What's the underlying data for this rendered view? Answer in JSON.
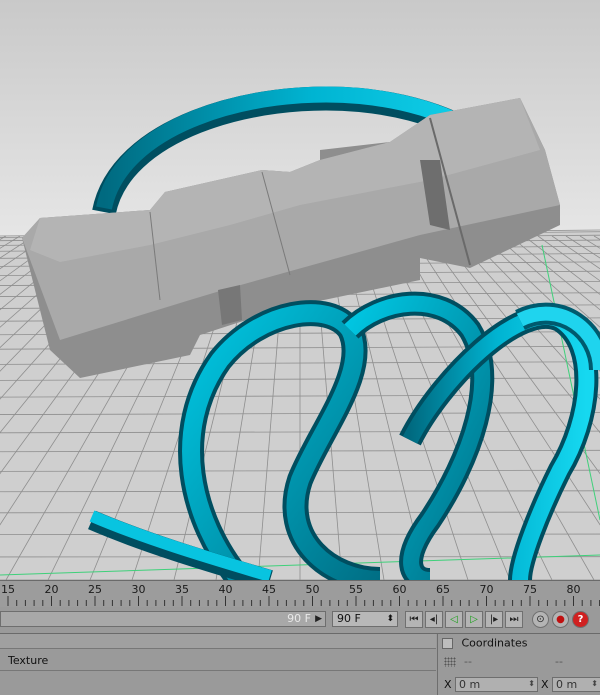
{
  "timeline": {
    "ticks": [
      "15",
      "20",
      "25",
      "30",
      "35",
      "40",
      "45",
      "50",
      "55",
      "60",
      "65",
      "70",
      "75",
      "80"
    ]
  },
  "controls": {
    "start_frame": "90 F",
    "end_frame": "90 F",
    "accent_play": "#1aa01a"
  },
  "attributes": {
    "texture_label": "Texture",
    "coordinates_label": "Coordinates",
    "dash_value_1": "--",
    "dash_value_2": "--",
    "x_label_1": "X",
    "x_value_1": "0 m",
    "x_label_2": "X",
    "x_value_2": "0 m"
  },
  "scene": {
    "object_color": "#00b4d2",
    "text_color": "#8c8c8c"
  }
}
